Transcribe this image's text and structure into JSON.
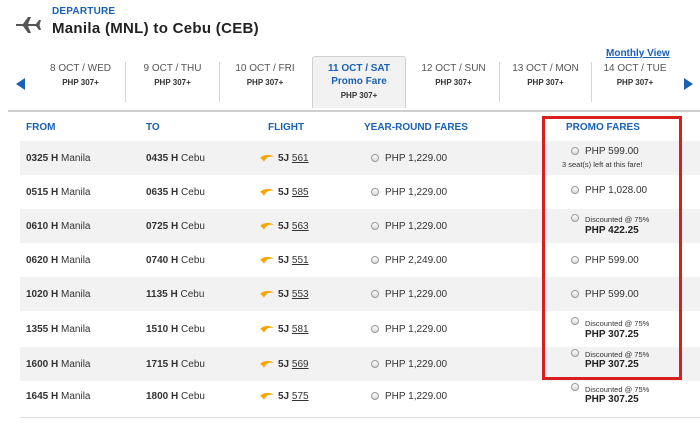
{
  "header": {
    "departure_label": "DEPARTURE",
    "route": "Manila (MNL) to Cebu (CEB)"
  },
  "monthly_view": "Monthly View",
  "dates": [
    {
      "date": "8 OCT / WED",
      "price": "PHP 307+"
    },
    {
      "date": "9 OCT / THU",
      "price": "PHP 307+"
    },
    {
      "date": "10 OCT / FRI",
      "price": "PHP 307+"
    },
    {
      "date": "11 OCT / SAT",
      "sub": "Promo Fare",
      "price": "PHP  307+"
    },
    {
      "date": "12 OCT / SUN",
      "price": "PHP 307+"
    },
    {
      "date": "13 OCT / MON",
      "price": "PHP 307+"
    },
    {
      "date": "14 OCT / TUE",
      "price": "PHP 307+"
    }
  ],
  "columns": {
    "from": "FROM",
    "to": "TO",
    "flight": "FLIGHT",
    "year_round": "YEAR-ROUND FARES",
    "promo": "PROMO FARES"
  },
  "flights": [
    {
      "dep_time": "0325 H",
      "dep_city": "Manila",
      "arr_time": "0435 H",
      "arr_city": "Cebu",
      "airline": "5J",
      "number": "561",
      "yr_fare": "PHP  1,229.00",
      "promo_price": "PHP  599.00",
      "seats": "3 seat(s) left at this fare!"
    },
    {
      "dep_time": "0515 H",
      "dep_city": "Manila",
      "arr_time": "0635 H",
      "arr_city": "Cebu",
      "airline": "5J",
      "number": "585",
      "yr_fare": "PHP  1,229.00",
      "promo_price": "PHP  1,028.00"
    },
    {
      "dep_time": "0610 H",
      "dep_city": "Manila",
      "arr_time": "0725 H",
      "arr_city": "Cebu",
      "airline": "5J",
      "number": "563",
      "yr_fare": "PHP  1,229.00",
      "discount": "Discounted @ 75%",
      "promo_price": "PHP  422.25"
    },
    {
      "dep_time": "0620 H",
      "dep_city": "Manila",
      "arr_time": "0740 H",
      "arr_city": "Cebu",
      "airline": "5J",
      "number": "551",
      "yr_fare": "PHP  2,249.00",
      "promo_price": "PHP  599.00"
    },
    {
      "dep_time": "1020 H",
      "dep_city": "Manila",
      "arr_time": "1135 H",
      "arr_city": "Cebu",
      "airline": "5J",
      "number": "553",
      "yr_fare": "PHP  1,229.00",
      "promo_price": "PHP  599.00"
    },
    {
      "dep_time": "1355 H",
      "dep_city": "Manila",
      "arr_time": "1510 H",
      "arr_city": "Cebu",
      "airline": "5J",
      "number": "581",
      "yr_fare": "PHP  1,229.00",
      "discount": "Discounted @ 75%",
      "promo_price": "PHP  307.25"
    },
    {
      "dep_time": "1600 H",
      "dep_city": "Manila",
      "arr_time": "1715 H",
      "arr_city": "Cebu",
      "airline": "5J",
      "number": "569",
      "yr_fare": "PHP  1,229.00",
      "discount": "Discounted @ 75%",
      "promo_price": "PHP  307.25"
    },
    {
      "dep_time": "1645 H",
      "dep_city": "Manila",
      "arr_time": "1800 H",
      "arr_city": "Cebu",
      "airline": "5J",
      "number": "575",
      "yr_fare": "PHP  1,229.00",
      "discount": "Discounted @ 75%",
      "promo_price": "PHP  307.25"
    }
  ],
  "colors": {
    "accent": "#1a61b5",
    "highlight": "#d81e1e",
    "plane": "#f7a600"
  }
}
